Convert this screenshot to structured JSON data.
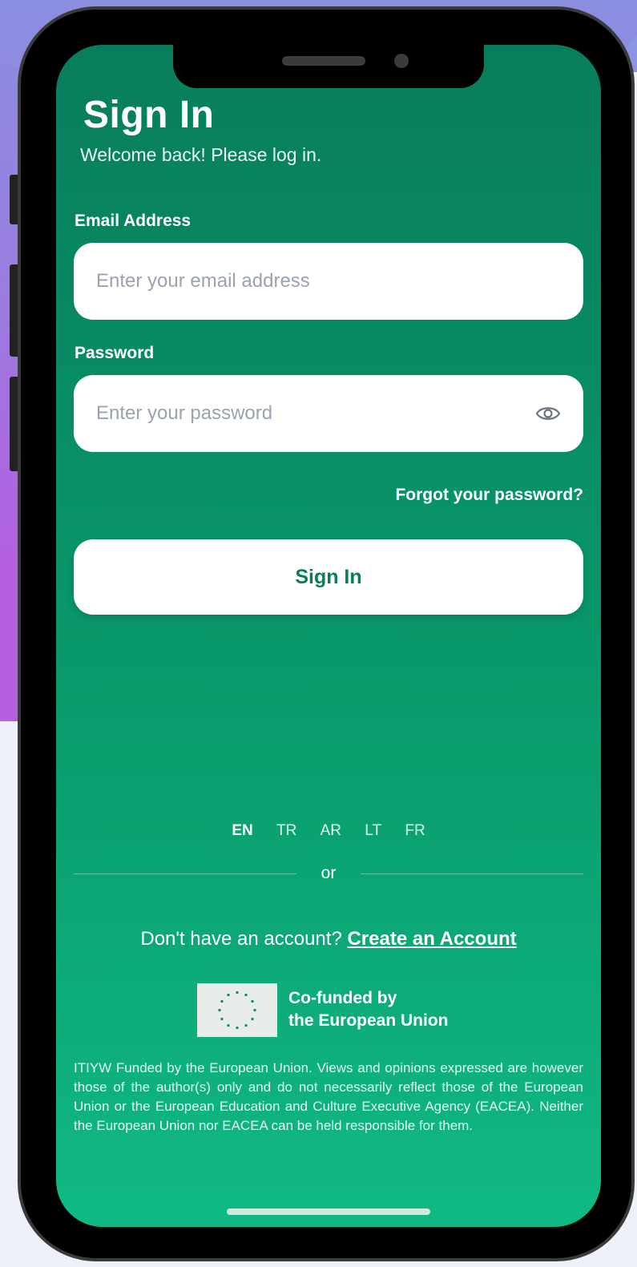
{
  "header": {
    "title": "Sign In",
    "subtitle": "Welcome back! Please log in."
  },
  "email": {
    "label": "Email Address",
    "placeholder": "Enter your email address"
  },
  "password": {
    "label": "Password",
    "placeholder": "Enter your password",
    "toggle_icon": "eye-icon"
  },
  "forgot_label": "Forgot your password?",
  "signin_button": "Sign In",
  "languages": [
    "EN",
    "TR",
    "AR",
    "LT",
    "FR"
  ],
  "active_language": "EN",
  "or_label": "or",
  "account": {
    "prompt": "Don't have an account?",
    "link": "Create an Account"
  },
  "funding": {
    "line1": "Co-funded by",
    "line2": "the European Union"
  },
  "disclaimer": "ITIYW Funded by the European Union. Views and opinions expressed are however those of the author(s) only and do not necessarily reflect those of the European Union or the European Education and Culture Executive Agency (EACEA). Neither the European Union nor EACEA can be held responsible for them.",
  "colors": {
    "accent": "#0a7e58",
    "screen_top": "#087d5c",
    "screen_bottom": "#10b984",
    "eu_star": "#0a8a5e"
  }
}
